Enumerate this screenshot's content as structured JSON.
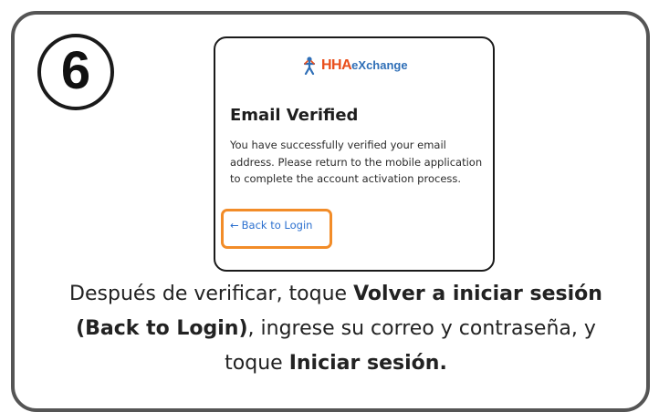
{
  "step": {
    "number": "6"
  },
  "screen": {
    "logo": {
      "brand_part1": "HHA",
      "brand_part2": "eXchange",
      "brand_color": "#e94e1b",
      "secondary_color": "#2f6fb7",
      "icon": "person-figure-icon"
    },
    "title": "Email Verified",
    "body": "You have successfully verified your email address. Please return to the mobile application to complete the account activation process.",
    "back_link": {
      "arrow": "←",
      "label": "Back to Login",
      "color": "#2a6fcf"
    },
    "highlight_color": "#f28c28"
  },
  "caption": {
    "part1": "Después de verificar, toque ",
    "bold1": "Volver a iniciar sesión (Back to Login)",
    "part2": ", ingrese su correo y contraseña, y toque ",
    "bold2": "Iniciar sesión."
  }
}
